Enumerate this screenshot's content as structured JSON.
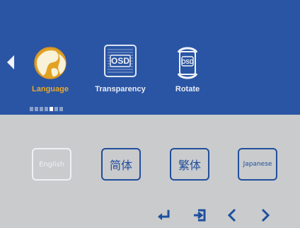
{
  "menu": {
    "items": [
      {
        "label": "Language",
        "icon": "globe-icon"
      },
      {
        "label": "Transparency",
        "icon": "osd-transparency-icon"
      },
      {
        "label": "Rotate",
        "icon": "osd-rotate-icon"
      }
    ],
    "osd_text": "OSD",
    "left_arrow_icon": "left-arrow-icon"
  },
  "page_indicator": {
    "total": 7,
    "active_index": 4
  },
  "language_options": [
    {
      "label": "English",
      "selected": false
    },
    {
      "label": "简体",
      "selected": true
    },
    {
      "label": "繁体",
      "selected": true
    },
    {
      "label": "Japanese",
      "selected": true
    }
  ],
  "bottom_controls": [
    {
      "name": "enter-icon"
    },
    {
      "name": "exit-icon"
    },
    {
      "name": "left-icon"
    },
    {
      "name": "right-icon"
    }
  ],
  "colors": {
    "top_panel": "#2a55a5",
    "bottom_panel": "#c9cbcd",
    "active_label": "#e8a82a",
    "button_blue": "#224e9c",
    "text_light": "#eef1f4"
  }
}
